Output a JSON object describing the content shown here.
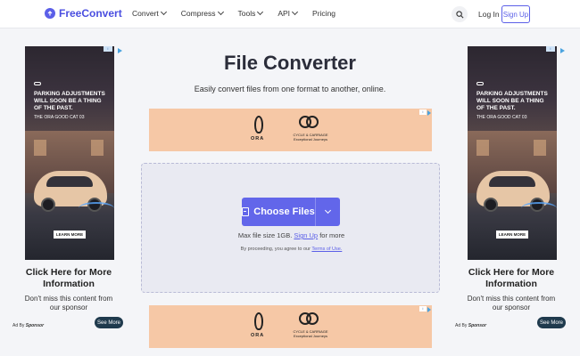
{
  "header": {
    "logo_text": "FreeConvert",
    "nav": [
      "Convert",
      "Compress",
      "Tools",
      "API",
      "Pricing"
    ],
    "login_label": "Log In",
    "signup_label": "Sign Up"
  },
  "main": {
    "title": "File Converter",
    "subtitle": "Easily convert files from one format to another, online.",
    "choose_files_label": "Choose Files",
    "max_size_text": "Max file size 1GB.",
    "max_size_link": "Sign Up",
    "max_size_suffix": "for more",
    "terms_prefix": "By proceeding, you agree to our",
    "terms_link": "Terms of Use."
  },
  "banner_ad": {
    "brand_1": "ORA",
    "brand_2": "CYCLE & CARRIAGE",
    "brand_2_tagline": "Exceptional Journeys"
  },
  "side_ad": {
    "headline": "PARKING ADJUSTMENTS WILL SOON BE A THING OF THE PAST.",
    "sub": "THE ORA GOOD CAT 03",
    "learn_more": "LEARN MORE",
    "cta_title": "Click Here for More Information",
    "cta_text": "Don't miss this content from our sponsor",
    "ad_by": "Ad By",
    "sponsor": "Sponsor",
    "see_more": "See More"
  },
  "colors": {
    "accent": "#6266ea",
    "banner_bg": "#f6c8a6"
  }
}
